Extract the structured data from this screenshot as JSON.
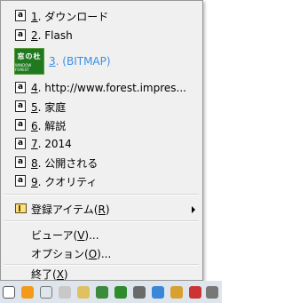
{
  "menu": {
    "items": [
      {
        "num": "1",
        "text": "ダウンロード",
        "icon": "a"
      },
      {
        "num": "2",
        "text": "Flash",
        "icon": "a"
      },
      {
        "num": "3",
        "text": "(BITMAP)",
        "thumb_title": "窓の杜",
        "thumb_sub": "WINDOW FOREST"
      },
      {
        "num": "4",
        "text": "http://www.forest.impres...",
        "icon": "a"
      },
      {
        "num": "5",
        "text": "家庭",
        "icon": "a"
      },
      {
        "num": "6",
        "text": "解説",
        "icon": "a"
      },
      {
        "num": "7",
        "text": "2014",
        "icon": "a"
      },
      {
        "num": "8",
        "text": "公開される",
        "icon": "a"
      },
      {
        "num": "9",
        "text": "クオリティ",
        "icon": "a"
      }
    ],
    "registered": {
      "label": "登録アイテム(",
      "key": "R",
      "suffix": ")"
    },
    "viewer": {
      "label": "ビューア(",
      "key": "V",
      "suffix": ")..."
    },
    "options": {
      "label": "オプション(",
      "key": "O",
      "suffix": ")..."
    },
    "exit": {
      "label": "終了(",
      "key": "X",
      "suffix": ")"
    }
  },
  "colors": {
    "bitmap_label": "#3a8ee6",
    "menu_bg": "#f0f0f0"
  }
}
